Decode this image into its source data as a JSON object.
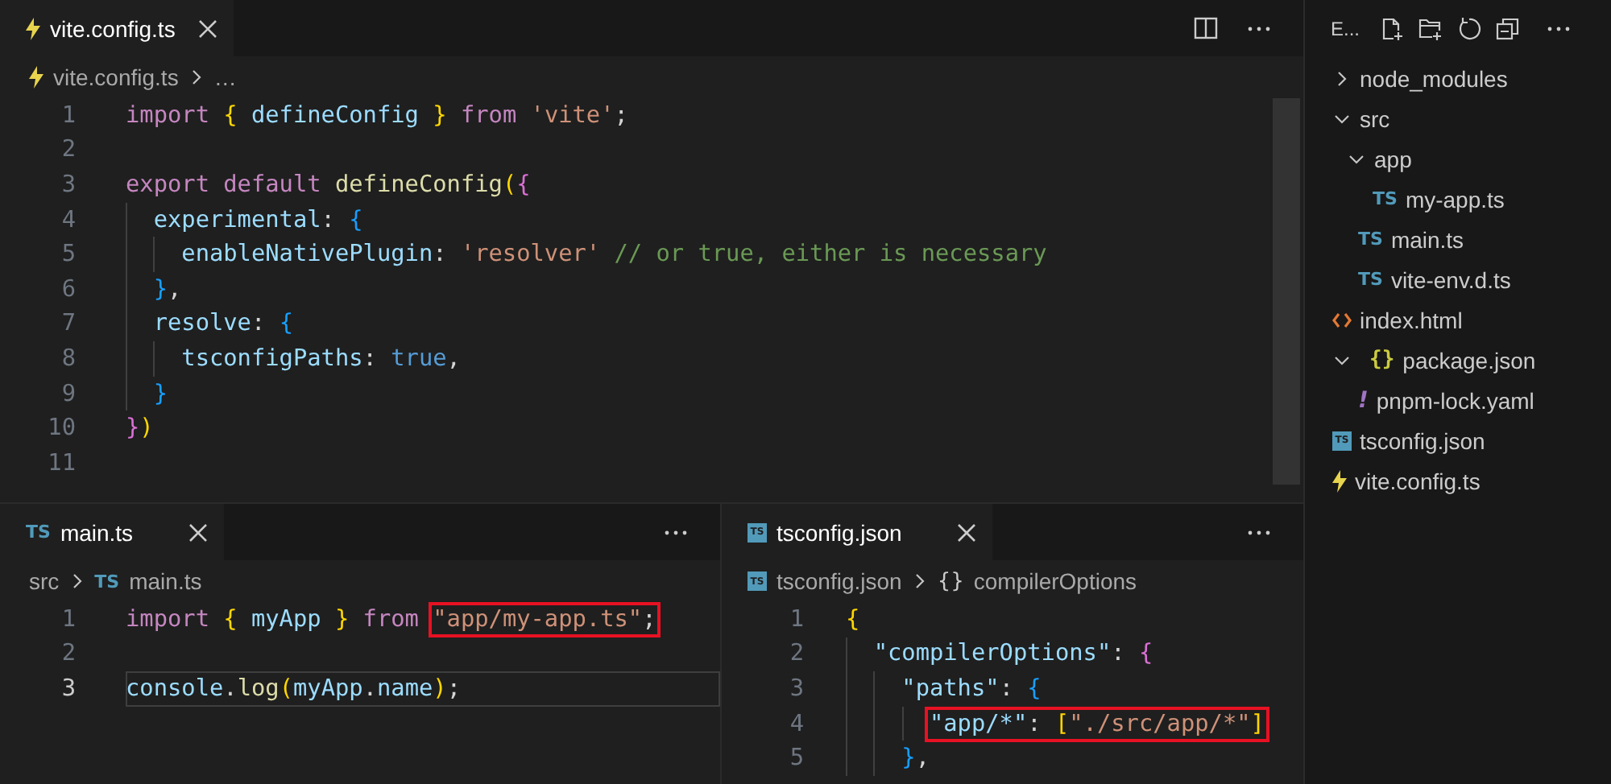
{
  "editor_groups": [
    {
      "tabs": [
        {
          "label": "vite.config.ts",
          "icon": {
            "kind": "vite"
          },
          "selected": true
        }
      ],
      "breadcrumb": [
        {
          "label": "vite.config.ts",
          "icon": {
            "kind": "vite"
          }
        },
        {
          "label": "…"
        }
      ],
      "lines": [
        {
          "number": "1",
          "current": false,
          "tokens": [
            {
              "text": "import ",
              "kind": "kw"
            },
            {
              "text": "{ ",
              "kind": "br1"
            },
            {
              "text": "defineConfig ",
              "kind": "var"
            },
            {
              "text": "} ",
              "kind": "br1"
            },
            {
              "text": "from ",
              "kind": "kw"
            },
            {
              "text": "'vite'",
              "kind": "str"
            },
            {
              "text": ";",
              "kind": "punc"
            }
          ]
        },
        {
          "number": "2",
          "current": false
        },
        {
          "number": "3",
          "current": false,
          "tokens": [
            {
              "text": "export default ",
              "kind": "kw"
            },
            {
              "text": "defineConfig",
              "kind": "fn"
            },
            {
              "text": "(",
              "kind": "br1"
            },
            {
              "text": "{",
              "kind": "br2"
            }
          ]
        },
        {
          "number": "4",
          "current": false,
          "tokens": [
            {
              "text": "  experimental",
              "kind": "var"
            },
            {
              "text": ": ",
              "kind": "punc"
            },
            {
              "text": "{",
              "kind": "br3"
            }
          ]
        },
        {
          "number": "5",
          "current": false,
          "tokens": [
            {
              "text": "    enableNativePlugin",
              "kind": "var"
            },
            {
              "text": ": ",
              "kind": "punc"
            },
            {
              "text": "'resolver'",
              "kind": "str"
            },
            {
              "text": " // or true, either is necessary",
              "kind": "com"
            }
          ]
        },
        {
          "number": "6",
          "current": false,
          "tokens": [
            {
              "text": "  }",
              "kind": "br3"
            },
            {
              "text": ",",
              "kind": "punc"
            }
          ]
        },
        {
          "number": "7",
          "current": false,
          "tokens": [
            {
              "text": "  resolve",
              "kind": "var"
            },
            {
              "text": ": ",
              "kind": "punc"
            },
            {
              "text": "{",
              "kind": "br3"
            }
          ]
        },
        {
          "number": "8",
          "current": false,
          "tokens": [
            {
              "text": "    tsconfigPaths",
              "kind": "var"
            },
            {
              "text": ": ",
              "kind": "punc"
            },
            {
              "text": "true",
              "kind": "bool"
            },
            {
              "text": ",",
              "kind": "punc"
            }
          ]
        },
        {
          "number": "9",
          "current": false,
          "tokens": [
            {
              "text": "  }",
              "kind": "br3"
            }
          ]
        },
        {
          "number": "10",
          "current": false,
          "tokens": [
            {
              "text": "}",
              "kind": "br2"
            },
            {
              "text": ")",
              "kind": "br1"
            }
          ]
        },
        {
          "number": "11",
          "current": false
        }
      ]
    },
    {
      "tabs": [
        {
          "label": "main.ts",
          "icon": {
            "kind": "ts",
            "glyph": "TS"
          },
          "selected": true
        }
      ],
      "breadcrumb": [
        {
          "label": "src"
        },
        {
          "label": "main.ts",
          "icon": {
            "kind": "ts",
            "glyph": "TS"
          }
        }
      ],
      "lines": [
        {
          "number": "1",
          "current": false,
          "tokens": [
            {
              "text": "import ",
              "kind": "kw"
            },
            {
              "text": "{ ",
              "kind": "br1"
            },
            {
              "text": "myApp ",
              "kind": "var"
            },
            {
              "text": "} ",
              "kind": "br1"
            },
            {
              "text": "from ",
              "kind": "kw"
            }
          ],
          "boxed": [
            {
              "text": "\"app/my-app.ts\"",
              "kind": "str"
            },
            {
              "text": ";",
              "kind": "punc"
            }
          ]
        },
        {
          "number": "2",
          "current": false
        },
        {
          "number": "3",
          "current": true,
          "tokens": [
            {
              "text": "console",
              "kind": "var"
            },
            {
              "text": ".",
              "kind": "punc"
            },
            {
              "text": "log",
              "kind": "fn"
            },
            {
              "text": "(",
              "kind": "br1"
            },
            {
              "text": "myApp",
              "kind": "var"
            },
            {
              "text": ".",
              "kind": "punc"
            },
            {
              "text": "name",
              "kind": "var"
            },
            {
              "text": ")",
              "kind": "br1"
            },
            {
              "text": ";",
              "kind": "punc"
            }
          ]
        }
      ]
    },
    {
      "tabs": [
        {
          "label": "tsconfig.json",
          "icon": {
            "kind": "tsconfig",
            "glyph": "TS"
          },
          "selected": true
        }
      ],
      "breadcrumb": [
        {
          "label": "tsconfig.json",
          "icon": {
            "kind": "tsconfig",
            "glyph": "TS"
          }
        },
        {
          "label": "compilerOptions",
          "icon": {
            "kind": "symbol",
            "glyph": "{}"
          }
        }
      ],
      "lines": [
        {
          "number": "1",
          "current": false,
          "tokens": [
            {
              "text": "{",
              "kind": "br1"
            }
          ]
        },
        {
          "number": "2",
          "current": false,
          "tokens": [
            {
              "text": "  \"compilerOptions\"",
              "kind": "var"
            },
            {
              "text": ": ",
              "kind": "punc"
            },
            {
              "text": "{",
              "kind": "br2"
            }
          ]
        },
        {
          "number": "3",
          "current": false,
          "tokens": [
            {
              "text": "    \"paths\"",
              "kind": "var"
            },
            {
              "text": ": ",
              "kind": "punc"
            },
            {
              "text": "{",
              "kind": "br3"
            }
          ]
        },
        {
          "number": "4",
          "current": false,
          "boxed": [
            {
              "text": "      \"app/*\"",
              "kind": "var"
            },
            {
              "text": ": ",
              "kind": "punc"
            },
            {
              "text": "[",
              "kind": "br1"
            },
            {
              "text": "\"./src/app/*\"",
              "kind": "str"
            },
            {
              "text": "]",
              "kind": "br1"
            }
          ]
        },
        {
          "number": "5",
          "current": false,
          "tokens": [
            {
              "text": "    }",
              "kind": "br3"
            },
            {
              "text": ",",
              "kind": "punc"
            }
          ]
        }
      ]
    }
  ],
  "explorer": {
    "title": "E...",
    "items": [
      {
        "label": "node_modules",
        "kind": "folder",
        "expanded": false
      },
      {
        "label": "src",
        "kind": "folder",
        "expanded": true,
        "children": [
          {
            "label": "app",
            "kind": "folder",
            "expanded": true,
            "children": [
              {
                "label": "my-app.ts",
                "kind": "file",
                "icon": {
                  "kind": "ts",
                  "glyph": "TS"
                }
              }
            ]
          },
          {
            "label": "main.ts",
            "kind": "file",
            "icon": {
              "kind": "ts",
              "glyph": "TS"
            }
          },
          {
            "label": "vite-env.d.ts",
            "kind": "file",
            "icon": {
              "kind": "ts",
              "glyph": "TS"
            }
          }
        ]
      },
      {
        "label": "index.html",
        "kind": "file",
        "icon": {
          "kind": "html"
        }
      },
      {
        "label": "package.json",
        "kind": "nested",
        "expanded": true,
        "icon": {
          "kind": "json",
          "glyph": "{}"
        },
        "children": [
          {
            "label": "pnpm-lock.yaml",
            "kind": "file",
            "icon": {
              "kind": "yaml",
              "glyph": "!"
            }
          }
        ]
      },
      {
        "label": "tsconfig.json",
        "kind": "file",
        "icon": {
          "kind": "tsconfig",
          "glyph": "TS"
        }
      },
      {
        "label": "vite.config.ts",
        "kind": "file",
        "icon": {
          "kind": "vite"
        }
      }
    ]
  }
}
